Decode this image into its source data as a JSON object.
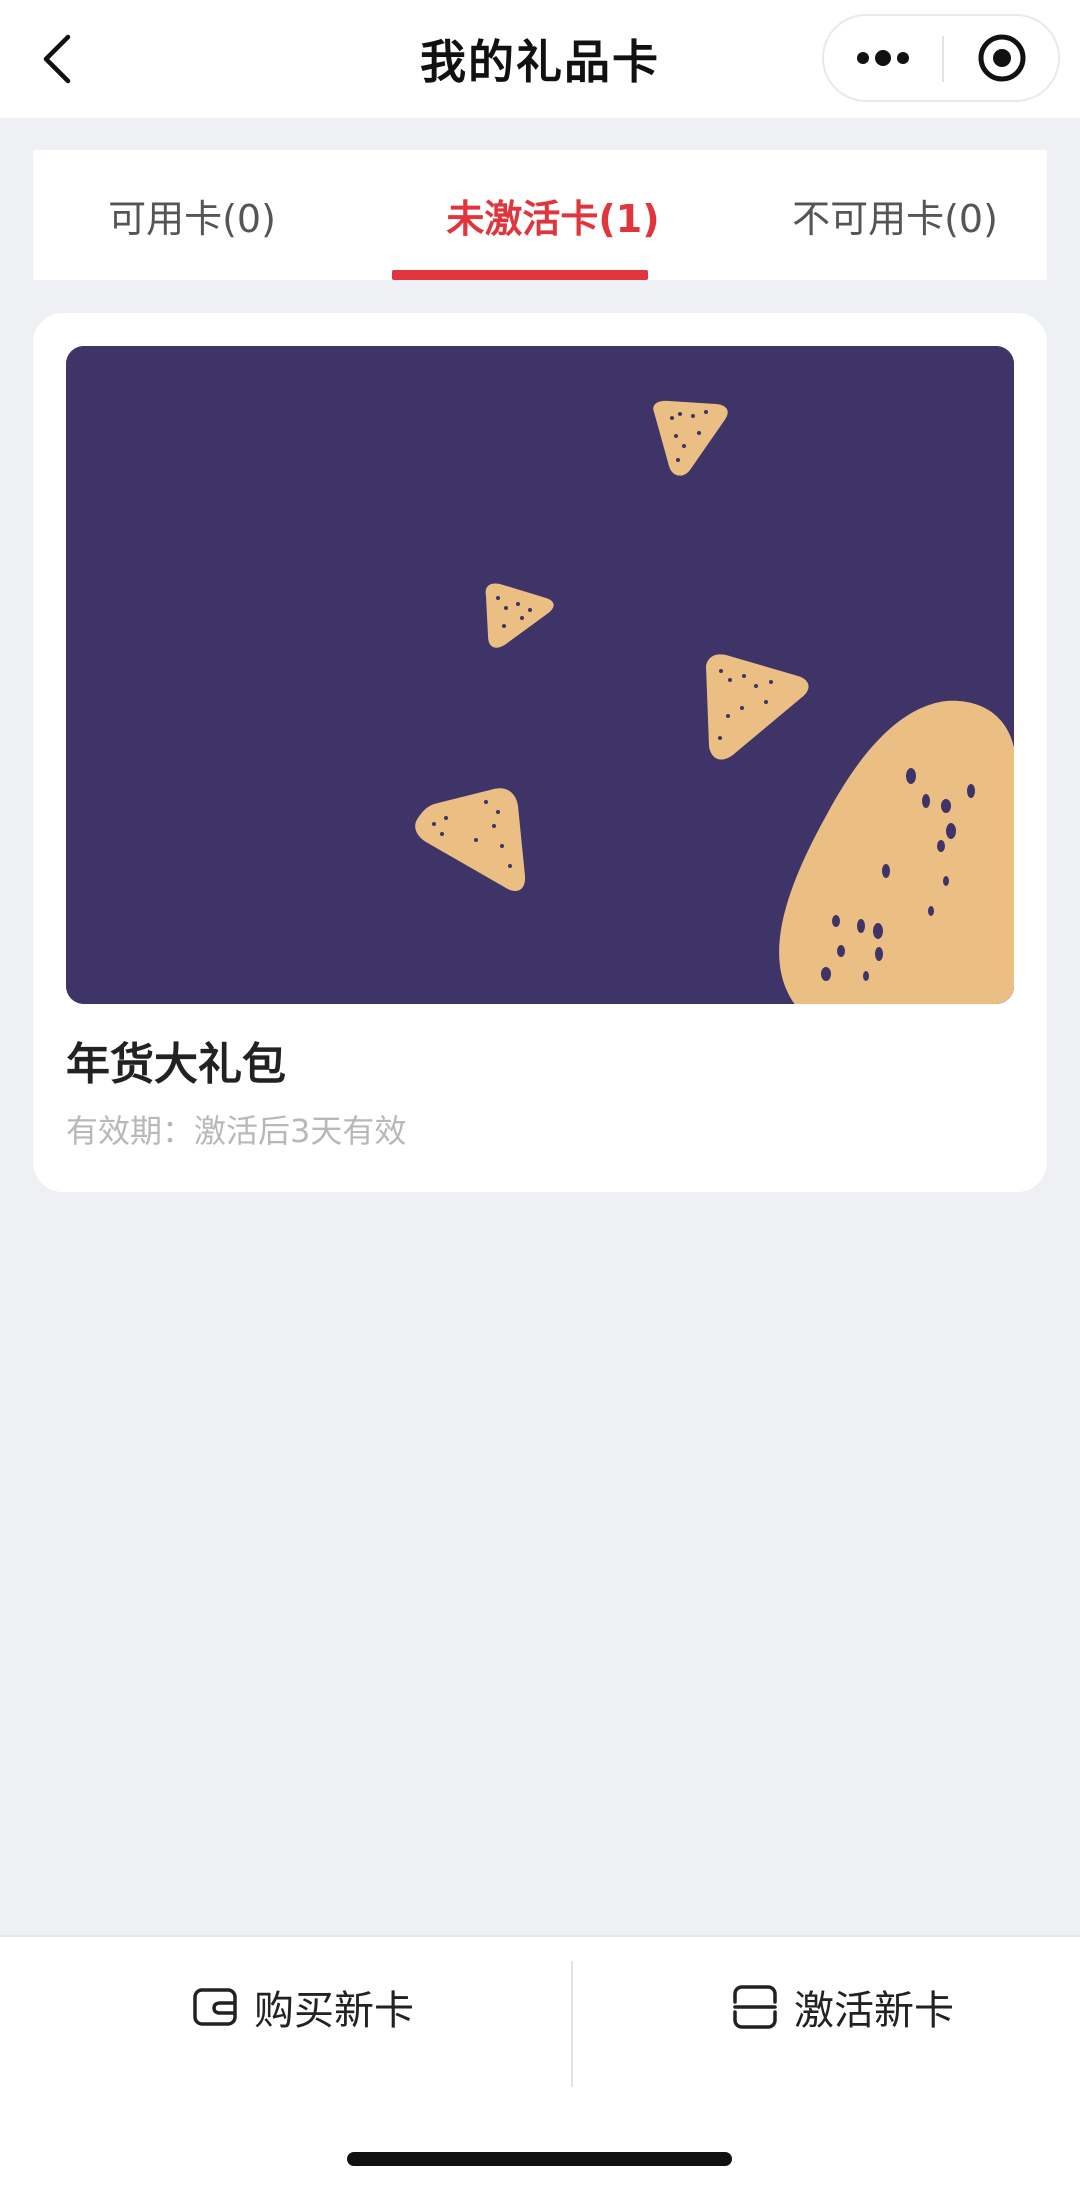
{
  "nav": {
    "title": "我的礼品卡",
    "back_icon": "chevron-left-icon",
    "more_icon": "more-dots-icon",
    "close_icon": "target-circle-icon"
  },
  "tabs": [
    {
      "label": "可用卡(0)",
      "active": false
    },
    {
      "label": "未激活卡(1)",
      "active": true
    },
    {
      "label": "不可用卡(0)",
      "active": false
    }
  ],
  "card": {
    "name": "年货大礼包",
    "validity": "有效期：激活后3天有效",
    "image_theme": "zongzi-dumplings-on-purple",
    "background_color": "#3e3468",
    "accent_color": "#ebbf84"
  },
  "bottom_bar": {
    "buy": {
      "label": "购买新卡",
      "icon": "wallet-icon"
    },
    "activate": {
      "label": "激活新卡",
      "icon": "card-scan-icon"
    }
  },
  "colors": {
    "accent": "#e1353d",
    "page_bg": "#eff0f4"
  }
}
